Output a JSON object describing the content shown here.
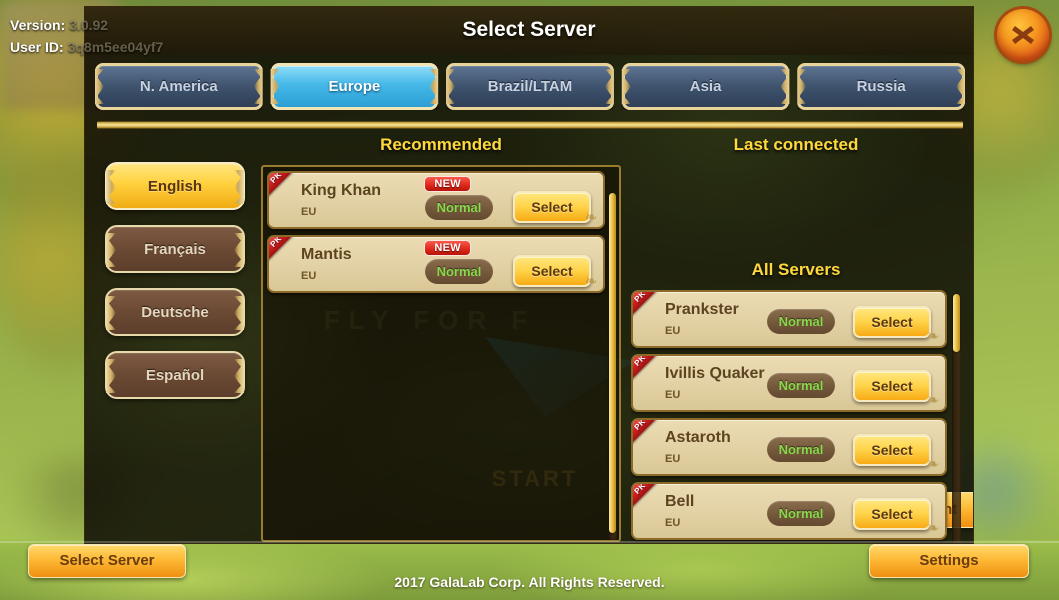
{
  "system": {
    "version_label": "Version:",
    "version_value": "3.0.92",
    "userid_label": "User ID:",
    "userid_value": "3q8m5ee04yf7"
  },
  "dialog": {
    "title": "Select Server",
    "close_icon": "close-icon"
  },
  "tabs": [
    {
      "label": "N. America",
      "active": false
    },
    {
      "label": "Europe",
      "active": true
    },
    {
      "label": "Brazil/LTAM",
      "active": false
    },
    {
      "label": "Asia",
      "active": false
    },
    {
      "label": "Russia",
      "active": false
    }
  ],
  "languages": [
    {
      "label": "English",
      "active": true
    },
    {
      "label": "Français",
      "active": false
    },
    {
      "label": "Deutsche",
      "active": false
    },
    {
      "label": "Español",
      "active": false
    }
  ],
  "sections": {
    "recommended_heading": "Recommended",
    "last_connected_heading": "Last connected",
    "all_servers_heading": "All Servers"
  },
  "recommended_servers": [
    {
      "name": "King Khan",
      "region": "EU",
      "badge": "NEW",
      "status": "Normal",
      "select": "Select",
      "pk": "PK"
    },
    {
      "name": "Mantis",
      "region": "EU",
      "badge": "NEW",
      "status": "Normal",
      "select": "Select",
      "pk": "PK"
    }
  ],
  "all_servers": [
    {
      "name": "Prankster",
      "region": "EU",
      "status": "Normal",
      "select": "Select",
      "pk": "PK"
    },
    {
      "name": "Ivillis Quaker",
      "region": "EU",
      "status": "Normal",
      "select": "Select",
      "pk": "PK"
    },
    {
      "name": "Astaroth",
      "region": "EU",
      "status": "Normal",
      "select": "Select",
      "pk": "PK"
    },
    {
      "name": "Bell",
      "region": "EU",
      "status": "Normal",
      "select": "Select",
      "pk": "PK"
    }
  ],
  "footer": {
    "select_server": "Select Server",
    "settings": "Settings",
    "account_partial": "unt",
    "copyright": "2017 GalaLab Corp. All Rights Reserved."
  },
  "background": {
    "logo_text": "FLY FOR F",
    "start_text": "START"
  },
  "colors": {
    "accent_gold": "#ffd83c",
    "tab_active": "#45b9e8",
    "status_green": "#88d94b",
    "badge_red": "#e02b1d",
    "panel_tan": "#e3d2a6"
  }
}
